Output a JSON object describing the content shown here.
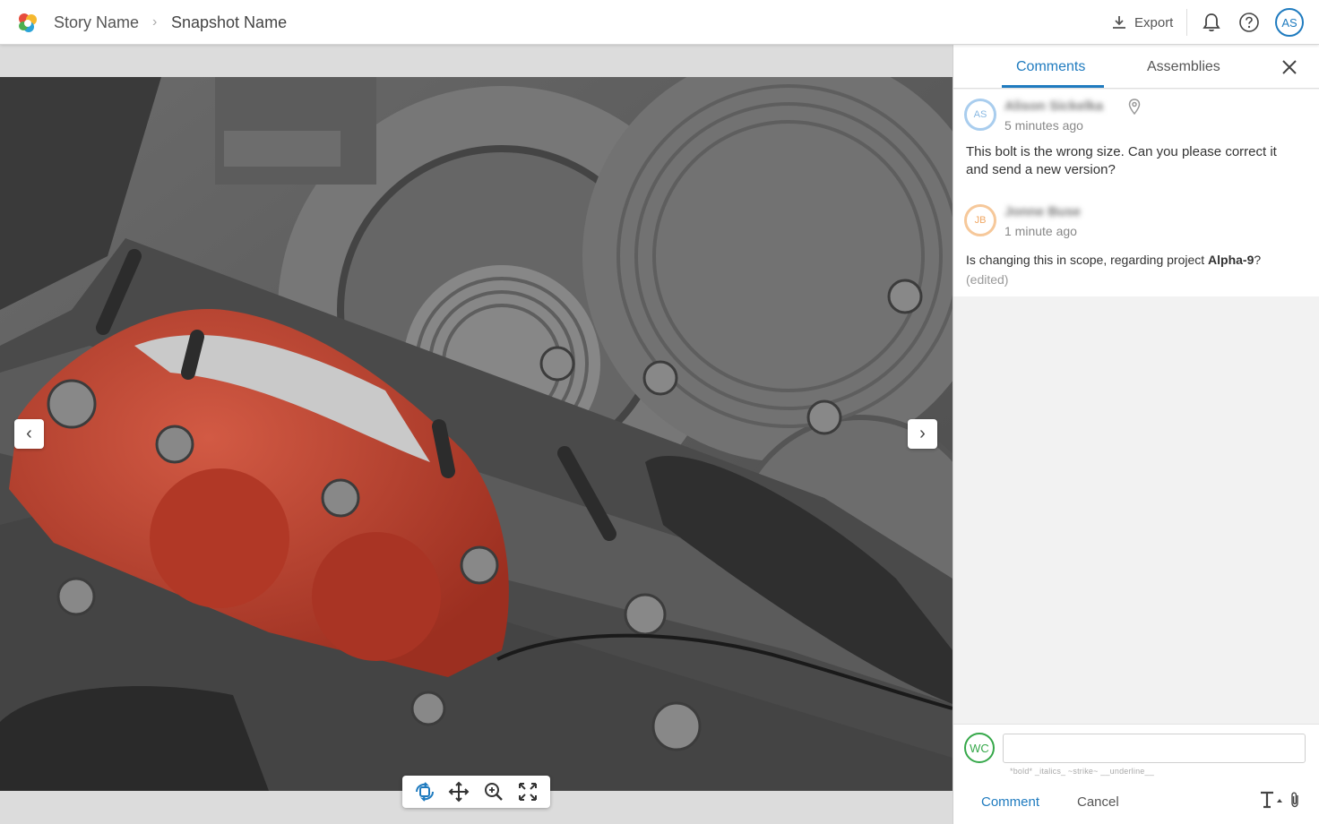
{
  "header": {
    "story_name": "Story Name",
    "separator": "›",
    "snapshot_name": "Snapshot Name",
    "export_label": "Export",
    "user_initials": "AS"
  },
  "viewer": {
    "prev_label": "‹",
    "next_label": "›",
    "tools": [
      "rotate-icon",
      "pan-icon",
      "zoom-icon",
      "fit-screen-icon"
    ]
  },
  "panel": {
    "tabs": [
      {
        "label": "Comments",
        "active": true
      },
      {
        "label": "Assemblies",
        "active": false
      }
    ],
    "comments": [
      {
        "initials": "AS",
        "author": "Alison Sickelka",
        "time": "5 minutes ago",
        "text": "This bolt is the wrong size. Can you please correct it and send a new version?",
        "has_pin": true
      },
      {
        "initials": "JB",
        "author": "Jonne Buse",
        "time": "1 minute ago",
        "text_prefix": "Is changing this in scope, regarding project ",
        "text_bold": "Alpha-9",
        "text_suffix": "?",
        "edited_label": "(edited)"
      }
    ],
    "composer": {
      "user_initials": "WC",
      "placeholder": "",
      "format_hint": "*bold*  _italics_  ~strike~  __underline__",
      "comment_label": "Comment",
      "cancel_label": "Cancel"
    }
  },
  "colors": {
    "accent": "#1f7bbf",
    "part_red": "#b83a28",
    "user_green": "#36a84a",
    "avatar_orange": "#f0a865"
  }
}
